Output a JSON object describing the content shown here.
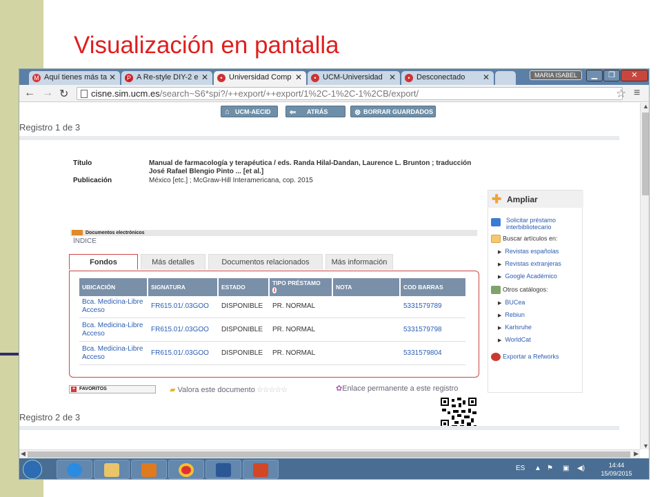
{
  "slide": {
    "title": "Visualización en pantalla"
  },
  "browser": {
    "tabs": [
      {
        "label": "Aquí tienes más ta",
        "icon": "gmail-icon",
        "color": "#d33"
      },
      {
        "label": "A Re-style DIY-2 e",
        "icon": "pinterest-icon",
        "color": "#cb2027"
      },
      {
        "label": "Universidad Comp",
        "icon": "ucm-icon",
        "color": "#c33",
        "active": true
      },
      {
        "label": "UCM-Universidad",
        "icon": "ucm-icon",
        "color": "#c33"
      },
      {
        "label": "Desconectado",
        "icon": "ucm-icon",
        "color": "#c33"
      }
    ],
    "user": "MARIA ISABEL",
    "url_domain": "cisne.sim.ucm.es",
    "url_path": "/search~S6*spi?/++export/++export/1%2C-1%2C-1%2CB/export/"
  },
  "toolbar": {
    "home": "UCM-AECID",
    "back": "ATRÁS",
    "clear": "BORRAR GUARDADOS"
  },
  "record1": {
    "header": "Registro 1 de 3",
    "title_label": "Título",
    "title_value": "Manual de farmacología y terapéutica / eds. Randa Hilal-Dandan, Laurence L. Brunton ; traducción José Rafael Blengio Pinto ... [et al.]",
    "pub_label": "Publicación",
    "pub_value": "México [etc.] ; McGraw-Hill Interamericana, cop. 2015",
    "docs_label": "Documentos electrónicos",
    "index_label": "ÍNDICE",
    "tabs": [
      "Fondos",
      "Más detalles",
      "Documentos relacionados",
      "Más información"
    ],
    "columns": [
      "UBICACIÓN",
      "SIGNATURA",
      "ESTADO",
      "TIPO PRÉSTAMO",
      "NOTA",
      "COD BARRAS"
    ],
    "rows": [
      [
        "Bca. Medicina-Libre Acceso",
        "FR615.01/.03GOO",
        "DISPONIBLE",
        "PR. NORMAL",
        "",
        "5331579789"
      ],
      [
        "Bca. Medicina-Libre Acceso",
        "FR615.01/.03GOO",
        "DISPONIBLE",
        "PR. NORMAL",
        "",
        "5331579798"
      ],
      [
        "Bca. Medicina-Libre Acceso",
        "FR615.01/.03GOO",
        "DISPONIBLE",
        "PR. NORMAL",
        "",
        "5331579804"
      ]
    ],
    "favorites": "FAVORITOS",
    "rate": "Valora este documento",
    "permalink": "Enlace permanente a este registro"
  },
  "sidebar": {
    "header": "Ampliar",
    "ill": "Solicitar préstamo interbibliotecario",
    "search_articles": "Buscar artículos en:",
    "articles": [
      "Revistas españolas",
      "Revistas extranjeras",
      "Google Académico"
    ],
    "other_catalogs": "Otros catálogos:",
    "catalogs": [
      "BUCea",
      "Rebiun",
      "Karlsruhe",
      "WorldCat"
    ],
    "refworks": "Exportar a Refworks"
  },
  "record2": {
    "header": "Registro 2 de 3"
  },
  "taskbar": {
    "lang": "ES",
    "time": "14:44",
    "date": "15/09/2015"
  }
}
